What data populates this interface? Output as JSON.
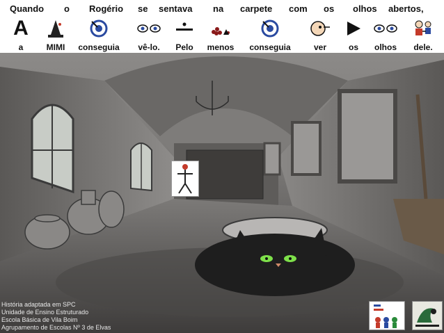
{
  "caption": {
    "line1": [
      "Quando",
      "o",
      "Rogério",
      "se",
      "sentava",
      "na",
      "carpete",
      "com",
      "os",
      "olhos",
      "abertos,"
    ],
    "line2": [
      {
        "label": "a",
        "icon": "letter-a-symbol"
      },
      {
        "label": "MIMI",
        "icon": "witch-hat-symbol"
      },
      {
        "label": "conseguia",
        "icon": "target-symbol"
      },
      {
        "label": "vê-lo.",
        "icon": "eyes-symbol"
      },
      {
        "label": "Pelo",
        "icon": "minus-symbol"
      },
      {
        "label": "menos",
        "icon": "fewer-dots-symbol"
      },
      {
        "label": "conseguia",
        "icon": "target-symbol"
      },
      {
        "label": "ver",
        "icon": "look-face-symbol"
      },
      {
        "label": "os",
        "icon": "play-triangle-symbol"
      },
      {
        "label": "olhos",
        "icon": "eyes-symbol"
      },
      {
        "label": "dele.",
        "icon": "his-person-symbol"
      }
    ]
  },
  "credits": [
    "História adaptada em SPC",
    "Unidade de Ensino Estruturado",
    "Escola Básica de Vila Boim",
    "Agrupamento  de Escolas Nº 3 de Elvas"
  ],
  "colors": {
    "scene_dark": "#4a4846",
    "scene_mid": "#7a7876",
    "cat_eye": "#7ee04a",
    "accent_red": "#c43a2a",
    "accent_blue": "#2a4aa0"
  }
}
